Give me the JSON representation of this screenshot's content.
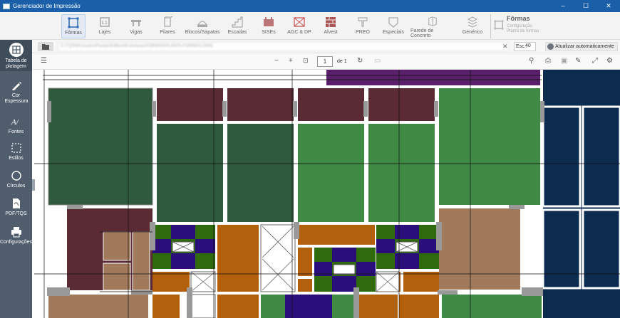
{
  "window": {
    "title": "Gerenciador de Impressão",
    "minimize": "–",
    "maximize": "☐",
    "close": "✕"
  },
  "ribbon": {
    "buttons": [
      {
        "label": "Fôrmas",
        "icon": "formas-icon"
      },
      {
        "label": "Lajes",
        "icon": "lajes-icon"
      },
      {
        "label": "Vigas",
        "icon": "vigas-icon"
      },
      {
        "label": "Pilares",
        "icon": "pilares-icon"
      },
      {
        "label": "Blocos/Sapatas",
        "icon": "blocos-icon"
      },
      {
        "label": "Escadas",
        "icon": "escadas-icon"
      },
      {
        "label": "SISEs",
        "icon": "sises-icon"
      },
      {
        "label": "AGC & DP",
        "icon": "agc-icon"
      },
      {
        "label": "Alvest",
        "icon": "alvest-icon"
      },
      {
        "label": "PREO",
        "icon": "preo-icon"
      },
      {
        "label": "Especiais",
        "icon": "especiais-icon"
      },
      {
        "label": "Parede de Concreto",
        "icon": "parede-icon"
      },
      {
        "label": "Genérico",
        "icon": "generico-icon"
      }
    ],
    "group": {
      "title": "Fôrmas",
      "line1": "Configuração",
      "line2": "Planta de formas"
    }
  },
  "sidebar": {
    "items": [
      {
        "label": "Tabela de plotagem",
        "icon": "table-icon"
      },
      {
        "label": "Cor Espessura",
        "icon": "pen-icon"
      },
      {
        "label": "Fontes",
        "icon": "font-icon"
      },
      {
        "label": "Estilos",
        "icon": "style-icon"
      },
      {
        "label": "Círculos",
        "icon": "circle-icon"
      },
      {
        "label": "PDF/TQS",
        "icon": "pdf-icon"
      },
      {
        "label": "Configurações",
        "icon": "printer-icon"
      }
    ]
  },
  "toolbar": {
    "path_value": "C:\\TQSW\\Usuario\\Pastas\\Edificio\\Estruturas\\FORMAS\\PLANTA-FORMAS.DWG",
    "clear": "✕",
    "esc_label": "Esc.:",
    "esc_value": "40",
    "auto_update_label": "Atualizar automaticamente"
  },
  "pdf_viewer": {
    "zoom_out": "−",
    "zoom_in": "+",
    "page": "1",
    "page_of": "de 1"
  },
  "colors": {
    "titlebar": "#1a5fa8",
    "sidebar": "#4f5d6d",
    "slab_dark_green": "#2f5a3e",
    "slab_green": "#3f8a45",
    "slab_maroon": "#5a2a35",
    "slab_purple": "#5a1f6a",
    "slab_navy": "#0d2a4f",
    "slab_orange": "#b2600c",
    "slab_tan": "#a07a5a",
    "slab_violet": "#2a0f7a",
    "slab_olive": "#2f6a0f"
  }
}
